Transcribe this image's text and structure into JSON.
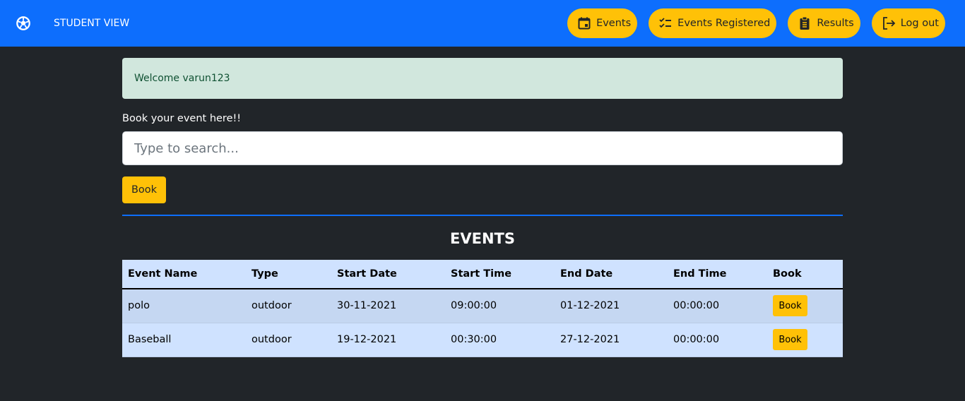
{
  "nav": {
    "brand": "STUDENT VIEW",
    "brand_icon": "soccer-ball-icon",
    "buttons": [
      {
        "label": "Events",
        "icon": "calendar-icon"
      },
      {
        "label": "Events Registered",
        "icon": "checklist-icon"
      },
      {
        "label": "Results",
        "icon": "clipboard-icon"
      },
      {
        "label": "Log out",
        "icon": "logout-icon"
      }
    ]
  },
  "colors": {
    "primary": "#0d6efd",
    "warning": "#ffc107",
    "background": "#212529",
    "alert": "#d1e7dd"
  },
  "alert": "Welcome varun123",
  "book_label": "Book your event here!!",
  "search": {
    "placeholder": "Type to search...",
    "value": ""
  },
  "book_button": "Book",
  "events": {
    "title": "EVENTS",
    "columns": [
      "Event Name",
      "Type",
      "Start Date",
      "Start Time",
      "End Date",
      "End Time",
      "Book"
    ],
    "rows": [
      [
        "polo",
        "outdoor",
        "30-11-2021",
        "09:00:00",
        "01-12-2021",
        "00:00:00",
        "Book"
      ],
      [
        "Baseball",
        "outdoor",
        "19-12-2021",
        "00:30:00",
        "27-12-2021",
        "00:00:00",
        "Book"
      ]
    ]
  }
}
